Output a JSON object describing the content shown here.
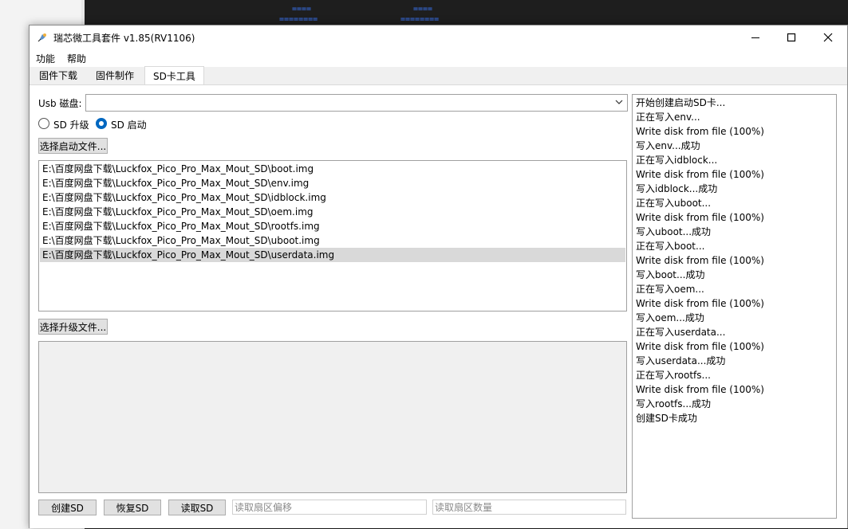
{
  "background": {
    "terminal_marks": [
      {
        "text": "===="
      },
      {
        "text": "========"
      },
      {
        "text": "===="
      },
      {
        "text": "========"
      }
    ]
  },
  "window": {
    "title": "瑞芯微工具套件 v1.85(RV1106)",
    "icon": "rockchip-app-icon",
    "controls": {
      "minimize": "minimize-icon",
      "maximize": "maximize-icon",
      "close": "close-icon"
    }
  },
  "menu": {
    "items": [
      {
        "label": "功能"
      },
      {
        "label": "帮助"
      }
    ]
  },
  "tabs": [
    {
      "label": "固件下载",
      "active": false
    },
    {
      "label": "固件制作",
      "active": false
    },
    {
      "label": "SD卡工具",
      "active": true
    }
  ],
  "sd_tool": {
    "usb_disk_label": "Usb 磁盘:",
    "usb_disk_value": "",
    "mode_options": [
      {
        "label": "SD 升级",
        "checked": false
      },
      {
        "label": "SD 启动",
        "checked": true
      }
    ],
    "select_boot_button": "选择启动文件...",
    "boot_files": [
      {
        "path": "E:\\百度网盘下载\\Luckfox_Pico_Pro_Max_Mout_SD\\boot.img",
        "selected": false
      },
      {
        "path": "E:\\百度网盘下载\\Luckfox_Pico_Pro_Max_Mout_SD\\env.img",
        "selected": false
      },
      {
        "path": "E:\\百度网盘下载\\Luckfox_Pico_Pro_Max_Mout_SD\\idblock.img",
        "selected": false
      },
      {
        "path": "E:\\百度网盘下载\\Luckfox_Pico_Pro_Max_Mout_SD\\oem.img",
        "selected": false
      },
      {
        "path": "E:\\百度网盘下载\\Luckfox_Pico_Pro_Max_Mout_SD\\rootfs.img",
        "selected": false
      },
      {
        "path": "E:\\百度网盘下载\\Luckfox_Pico_Pro_Max_Mout_SD\\uboot.img",
        "selected": false
      },
      {
        "path": "E:\\百度网盘下载\\Luckfox_Pico_Pro_Max_Mout_SD\\userdata.img",
        "selected": true
      }
    ],
    "select_upgrade_button": "选择升级文件...",
    "bottom": {
      "create_sd": "创建SD",
      "restore_sd": "恢复SD",
      "read_sd": "读取SD",
      "offset_placeholder": "读取扇区偏移",
      "count_placeholder": "读取扇区数量"
    },
    "log": [
      "开始创建启动SD卡...",
      "正在写入env...",
      "Write disk from file (100%)",
      "写入env...成功",
      "正在写入idblock...",
      "Write disk from file (100%)",
      "写入idblock...成功",
      "正在写入uboot...",
      "Write disk from file (100%)",
      "写入uboot...成功",
      "正在写入boot...",
      "Write disk from file (100%)",
      "写入boot...成功",
      "正在写入oem...",
      "Write disk from file (100%)",
      "写入oem...成功",
      "正在写入userdata...",
      "Write disk from file (100%)",
      "写入userdata...成功",
      "正在写入rootfs...",
      "Write disk from file (100%)",
      "写入rootfs...成功",
      "创建SD卡成功"
    ]
  }
}
